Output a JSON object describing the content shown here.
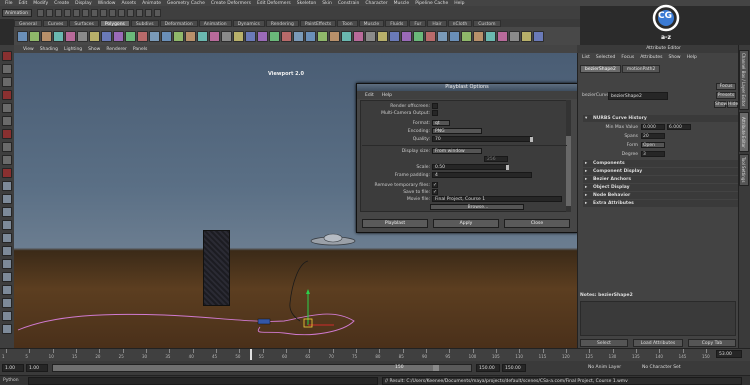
{
  "menubar": {
    "items": [
      "File",
      "Edit",
      "Modify",
      "Create",
      "Display",
      "Window",
      "Assets",
      "Animate",
      "Geometry Cache",
      "Create Deformers",
      "Edit Deformers",
      "Skeleton",
      "Skin",
      "Constrain",
      "Character",
      "Muscle",
      "Pipeline Cache",
      "Help"
    ]
  },
  "statusline": {
    "mode": "Animation"
  },
  "shelf": {
    "tabs": [
      "General",
      "Curves",
      "Surfaces",
      "Polygons",
      "Subdivs",
      "Deformation",
      "Animation",
      "Dynamics",
      "Rendering",
      "PaintEffects",
      "Toon",
      "Muscle",
      "Fluids",
      "Fur",
      "Hair",
      "nCloth",
      "Custom"
    ],
    "active_tab": "Polygons"
  },
  "panel_menu": {
    "items": [
      "View",
      "Shading",
      "Lighting",
      "Show",
      "Renderer",
      "Panels"
    ]
  },
  "viewport": {
    "label": "Viewport 2.0"
  },
  "playblast": {
    "title": "Playblast Options",
    "menu": [
      "Edit",
      "Help"
    ],
    "render_offscreen_label": "Render offscreen:",
    "multi_camera_label": "Multi-Camera Output:",
    "format_label": "Format:",
    "format_value": "qt",
    "encoding_label": "Encoding:",
    "encoding_value": "PNG",
    "quality_label": "Quality:",
    "quality_value": "70",
    "display_size_label": "Display size:",
    "display_size_value": "From window",
    "display_size_extra": "256",
    "scale_label": "Scale:",
    "scale_value": "0.50",
    "frame_padding_label": "Frame padding:",
    "frame_padding_value": "4",
    "remove_temp_label": "Remove temporary files:",
    "remove_temp_checked": "✓",
    "save_to_file_label": "Save to file:",
    "save_to_file_checked": "✓",
    "movie_file_label": "Movie file:",
    "movie_file_value": "Final Project, Course 1",
    "browse_label": "Browse...",
    "playblast_btn": "Playblast",
    "apply_btn": "Apply",
    "close_btn": "Close"
  },
  "attribute_editor": {
    "title": "Attribute Editor",
    "menu": [
      "List",
      "Selected",
      "Focus",
      "Attributes",
      "Show",
      "Help"
    ],
    "tabs": [
      "bezierShape2",
      "motionPath2"
    ],
    "node_label": "bezierCurve:",
    "node_value": "bezierShape2",
    "focus_btn": "Focus",
    "presets_btn": "Presets",
    "show_btn": "Show",
    "hide_btn": "Hide",
    "sections": {
      "nurbs_history": "NURBS Curve History",
      "components": "Components",
      "component_display": "Component Display",
      "bezier_anchors": "Bezier Anchors",
      "object_display": "Object Display",
      "node_behavior": "Node Behavior",
      "extra_attributes": "Extra Attributes"
    },
    "rows": {
      "min_max_label": "Min Max Value",
      "min_value": "0.000",
      "max_value": "6.000",
      "spans_label": "Spans",
      "spans_value": "20",
      "form_label": "Form",
      "form_value": "Open",
      "degree_label": "Degree",
      "degree_value": "3"
    },
    "notes_label": "Notes: bezierShape2",
    "select_btn": "Select",
    "load_attributes_btn": "Load Attributes",
    "copy_tab_btn": "Copy Tab",
    "side_tabs": [
      "Channel Box / Layer Editor",
      "Attribute Editor",
      "Tool Settings"
    ]
  },
  "time_slider": {
    "ticks": [
      "1",
      "5",
      "10",
      "15",
      "20",
      "25",
      "30",
      "35",
      "40",
      "45",
      "50",
      "55",
      "60",
      "65",
      "70",
      "75",
      "80",
      "85",
      "90",
      "95",
      "100",
      "105",
      "110",
      "115",
      "120",
      "125",
      "130",
      "135",
      "140",
      "145",
      "150"
    ],
    "current_frame": "53.00"
  },
  "range_slider": {
    "start": "1.00",
    "start2": "1.00",
    "range_label": "150",
    "end": "150.00",
    "end2": "150.00",
    "anim_layer": "No Anim Layer",
    "char_set": "No Character Set"
  },
  "command_line": {
    "language": "Python",
    "result": "// Result: C:/Users/Keenee/Documents/maya/projects/default/scenes/CSa-a.com/Final Project, Course 1.wmv"
  },
  "logo": {
    "text": "a-z",
    "letters": "CG"
  }
}
